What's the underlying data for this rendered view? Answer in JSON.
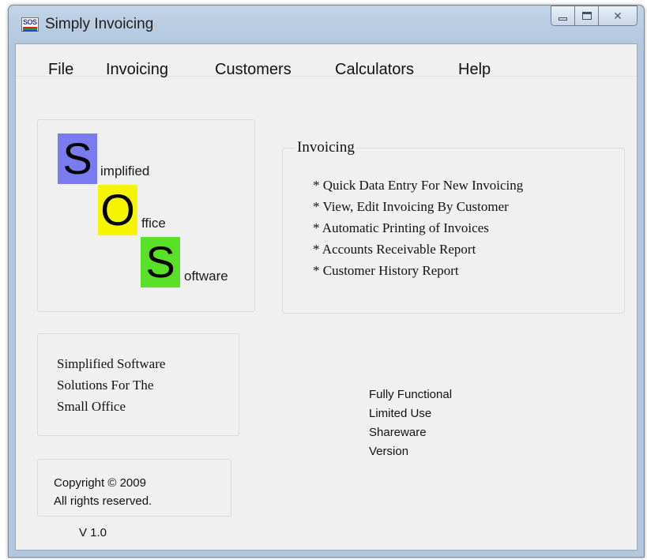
{
  "window": {
    "title": "Simply Invoicing",
    "icon": "sos-app-icon",
    "controls": [
      "minimize-icon",
      "maximize-icon",
      "close-icon"
    ],
    "close_glyph": "✕"
  },
  "menu": {
    "items": [
      {
        "label": "File"
      },
      {
        "label": "Invoicing"
      },
      {
        "label": "Customers"
      },
      {
        "label": "Calculators"
      },
      {
        "label": "Help"
      }
    ]
  },
  "logo": {
    "icon_text": "SOS",
    "letters": [
      {
        "letter": "S",
        "rest": "implified",
        "color": "#7b7bf0"
      },
      {
        "letter": "O",
        "rest": "ffice",
        "color": "#f5f500"
      },
      {
        "letter": "S",
        "rest": "oftware",
        "color": "#5ae028"
      }
    ]
  },
  "features": {
    "title": "Invoicing",
    "items": [
      "* Quick Data Entry For New Invoicing",
      "* View, Edit Invoicing By Customer",
      "* Automatic Printing of Invoices",
      "* Accounts Receivable Report",
      "* Customer History Report"
    ]
  },
  "tagline": {
    "lines": [
      "Simplified Software",
      "Solutions For The",
      "Small Office"
    ]
  },
  "license": {
    "lines": [
      "Fully Functional",
      "Limited Use",
      "Shareware",
      "Version"
    ]
  },
  "copyright": {
    "lines": [
      "Copyright ©  2009",
      "All rights reserved."
    ]
  },
  "version": "V 1.0",
  "colors": {
    "titlebar": "#b7cbe2",
    "client_bg": "#f0f0f0"
  }
}
